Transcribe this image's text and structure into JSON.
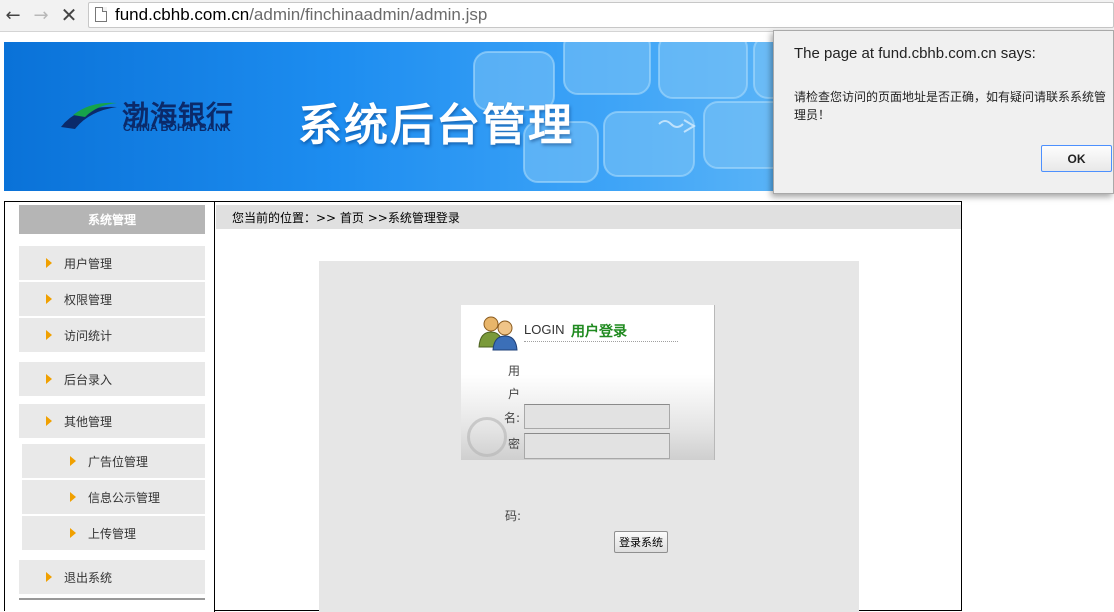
{
  "browser": {
    "url_host": "fund.cbhb.com.cn",
    "url_path": "/admin/finchinaadmin/admin.jsp"
  },
  "banner": {
    "logo_cn": "渤海银行",
    "logo_en": "CHINA BOHAI BANK",
    "title": "系统后台管理"
  },
  "dialog": {
    "title": "The page at fund.cbhb.com.cn says:",
    "message": "请检查您访问的页面地址是否正确，如有疑问请联系系统管理员！",
    "ok_label": "OK"
  },
  "sidebar": {
    "header": "系统管理",
    "items": [
      {
        "label": "用户管理"
      },
      {
        "label": "权限管理"
      },
      {
        "label": "访问统计"
      },
      {
        "label": "后台录入"
      },
      {
        "label": "其他管理"
      },
      {
        "label": "广告位管理"
      },
      {
        "label": "信息公示管理"
      },
      {
        "label": "上传管理"
      },
      {
        "label": "退出系统"
      }
    ]
  },
  "breadcrumb": "您当前的位置：>> 首页 >>系统管理登录",
  "login": {
    "title_en": "LOGIN",
    "title_cn": "用户登录",
    "username_label": [
      "用",
      "户",
      "名:"
    ],
    "password_label": [
      "密",
      "码:"
    ],
    "submit_label": "登录系统"
  },
  "colors": {
    "banner_blue": "#1d8df0",
    "menu_arrow": "#f0a000",
    "login_title": "#1f8a1f",
    "ok_focus": "#4d90fe"
  }
}
